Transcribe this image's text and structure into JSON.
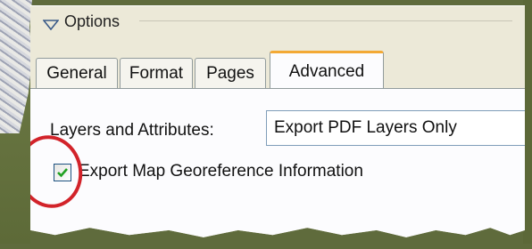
{
  "options": {
    "title": "Options"
  },
  "tabs": [
    {
      "label": "General"
    },
    {
      "label": "Format"
    },
    {
      "label": "Pages"
    },
    {
      "label": "Advanced",
      "active": true
    }
  ],
  "advanced": {
    "layers_label": "Layers and Attributes:",
    "layers_value": "Export PDF Layers Only",
    "georef_label": "Export Map Georeference Information",
    "georef_checked": true
  },
  "colors": {
    "accent_tab": "#f3a935",
    "highlight_circle": "#d2232a"
  }
}
